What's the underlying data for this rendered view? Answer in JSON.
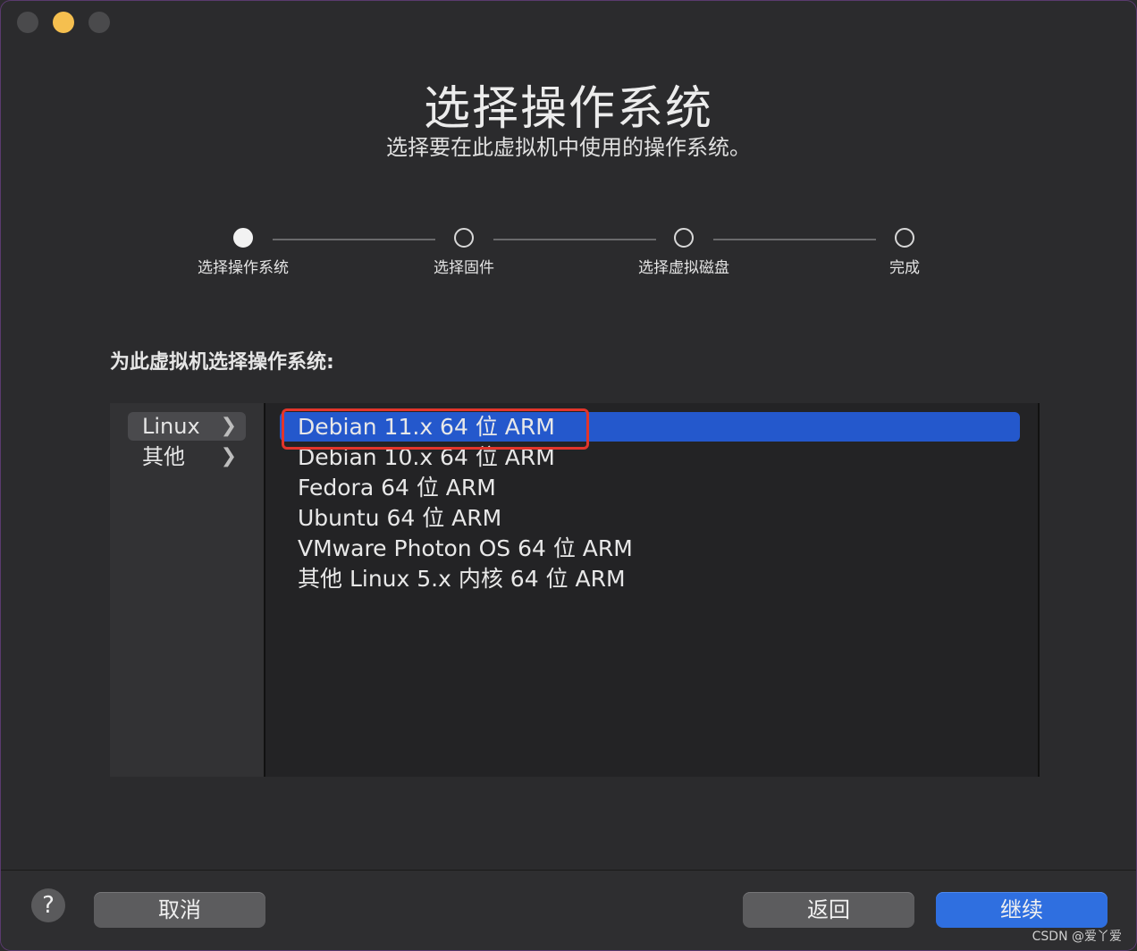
{
  "window": {
    "title": "选择操作系统",
    "subtitle": "选择要在此虚拟机中使用的操作系统。"
  },
  "steps": [
    {
      "label": "选择操作系统",
      "active": true
    },
    {
      "label": "选择固件",
      "active": false
    },
    {
      "label": "选择虚拟磁盘",
      "active": false
    },
    {
      "label": "完成",
      "active": false
    }
  ],
  "prompt": "为此虚拟机选择操作系统:",
  "categories": [
    {
      "label": "Linux",
      "selected": true
    },
    {
      "label": "其他",
      "selected": false
    }
  ],
  "os_list": [
    {
      "label": "Debian 11.x 64 位 ARM",
      "selected": true
    },
    {
      "label": "Debian 10.x 64 位 ARM",
      "selected": false
    },
    {
      "label": "Fedora 64 位 ARM",
      "selected": false
    },
    {
      "label": "Ubuntu 64 位 ARM",
      "selected": false
    },
    {
      "label": "VMware Photon OS 64 位 ARM",
      "selected": false
    },
    {
      "label": "其他 Linux 5.x 内核 64 位 ARM",
      "selected": false
    }
  ],
  "footer": {
    "help_label": "?",
    "cancel_label": "取消",
    "back_label": "返回",
    "continue_label": "继续"
  },
  "watermark": "CSDN @爱丫爱",
  "colors": {
    "accent": "#2458cc",
    "annotation": "#e2352b",
    "primary_button": "#2f6fe0"
  }
}
